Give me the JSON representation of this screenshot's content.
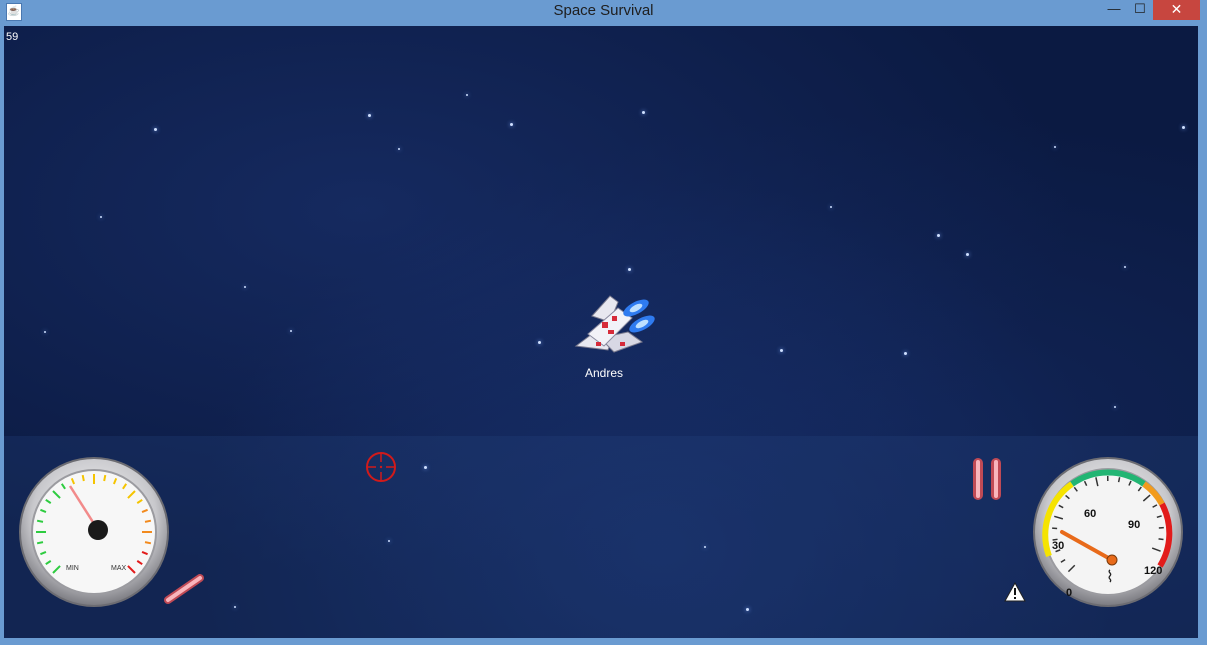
{
  "window": {
    "title": "Space Survival",
    "minimize_label": "—",
    "maximize_label": "☐",
    "close_label": "✕",
    "app_icon": "java-cup-icon"
  },
  "hud": {
    "fps": "59",
    "player_name": "Andres",
    "fuel_gauge": {
      "min_label": "MIN",
      "max_label": "MAX"
    },
    "temp_gauge": {
      "ticks": [
        "0",
        "30",
        "60",
        "90",
        "120"
      ],
      "value": 30
    },
    "crosshair_color": "#d11a1a",
    "laser_color": "#f47d86",
    "warning_icon": "warning-icon"
  },
  "colors": {
    "title_bar": "#6a9bd1",
    "space": "#0b1a42",
    "close_button": "#c7463f"
  }
}
